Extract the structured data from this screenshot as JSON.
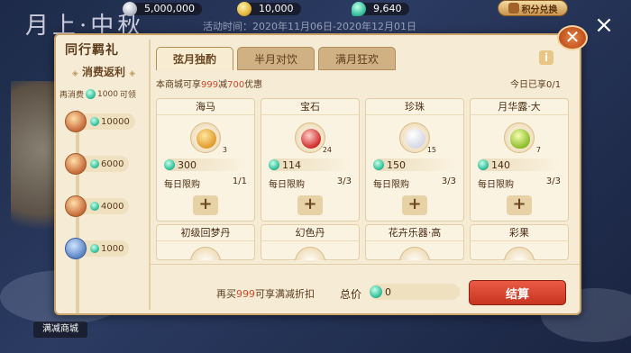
{
  "background": {
    "title": "月上·中秋"
  },
  "currency": {
    "silver": "5,000,000",
    "gold": "10,000",
    "jade": "9,640",
    "points_button": "积分兑换"
  },
  "event_time": "活动时间：2020年11月06日-2020年12月01日",
  "panel": {
    "title": "同行羁礼",
    "close_icon": "close-icon"
  },
  "sidebar": {
    "heading": "消费返利",
    "note_prefix": "再消费",
    "note_amount": "1000",
    "note_suffix": "可领",
    "tiers": [
      {
        "amount": "10000"
      },
      {
        "amount": "6000"
      },
      {
        "amount": "4000"
      },
      {
        "amount": "1000"
      }
    ]
  },
  "tabs": [
    {
      "label": "弦月独酌",
      "active": true
    },
    {
      "label": "半月对饮",
      "active": false
    },
    {
      "label": "满月狂欢",
      "active": false
    }
  ],
  "promo": {
    "prefix": "本商城可享",
    "threshold": "999",
    "mid": "减",
    "discount": "700",
    "suffix": "优惠"
  },
  "bought_today": "今日已享0/1",
  "items": [
    {
      "name": "海马",
      "qty": "3",
      "price": "300",
      "limit_label": "每日限购",
      "limit": "1/1"
    },
    {
      "name": "宝石",
      "qty": "24",
      "price": "114",
      "limit_label": "每日限购",
      "limit": "3/3"
    },
    {
      "name": "珍珠",
      "qty": "15",
      "price": "150",
      "limit_label": "每日限购",
      "limit": "3/3"
    },
    {
      "name": "月华露·大",
      "qty": "7",
      "price": "140",
      "limit_label": "每日限购",
      "limit": "3/3"
    },
    {
      "name": "初级回梦丹"
    },
    {
      "name": "幻色丹"
    },
    {
      "name": "花卉乐器·高"
    },
    {
      "name": "彩果"
    }
  ],
  "footer": {
    "rebuy_prefix": "再买",
    "rebuy_amount": "999",
    "rebuy_suffix": "可享满减折扣",
    "total_label": "总价",
    "total_value": "0",
    "checkout_label": "结算"
  },
  "shop_tag": "满减商城",
  "colors": {
    "accent": "#d04a2a",
    "checkout": "#c83522",
    "panel_bg": "#f6ecd6"
  }
}
